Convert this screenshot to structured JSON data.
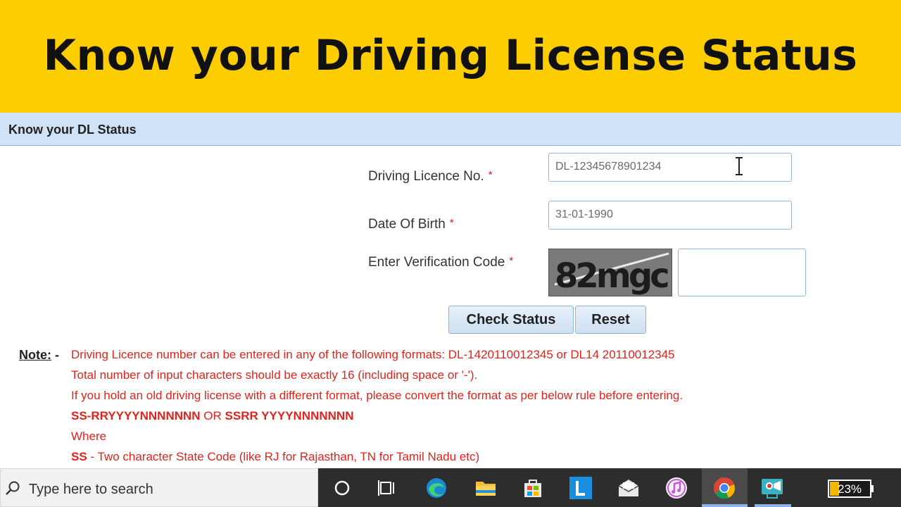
{
  "banner": {
    "title": "Know your Driving License Status"
  },
  "section": {
    "title": "Know your DL Status"
  },
  "form": {
    "dl_label": "Driving Licence No.",
    "dl_value": "DL-12345678901234",
    "dob_label": "Date Of Birth",
    "dob_value": "31-01-1990",
    "code_label": "Enter Verification Code",
    "required_marker": "*",
    "captcha_text": "82mgc",
    "code_value": ""
  },
  "buttons": {
    "check_status": "Check Status",
    "reset": "Reset"
  },
  "note": {
    "label": "Note:",
    "dash": "-",
    "line1": "Driving Licence number can be entered in any of the following formats: DL-1420110012345 or DL14 20110012345",
    "line2": "Total number of input characters should be exactly 16 (including space or '-').",
    "line3": "If you hold an old driving license with a different format, please convert the format as per below rule before entering.",
    "format_a": "SS-RRYYYYNNNNNNN",
    "format_or": "OR",
    "format_b": "SSRR YYYYNNNNNNN",
    "where": "Where",
    "ss_code": "SS",
    "ss_desc": "- Two character State Code (like RJ for Rajasthan, TN for Tamil Nadu etc)"
  },
  "taskbar": {
    "search_placeholder": "Type here to search",
    "battery": "23%",
    "icons": [
      "search-icon",
      "cortana-icon",
      "task-view-icon",
      "edge-icon",
      "file-explorer-icon",
      "store-icon",
      "l-app-icon",
      "mail-icon",
      "itunes-icon",
      "chrome-icon",
      "video-call-icon",
      "battery-icon"
    ]
  },
  "colors": {
    "banner": "#fccd00",
    "section_header": "#cfe2f6",
    "note_text": "#e0231b",
    "taskbar": "#2d2d2e"
  }
}
